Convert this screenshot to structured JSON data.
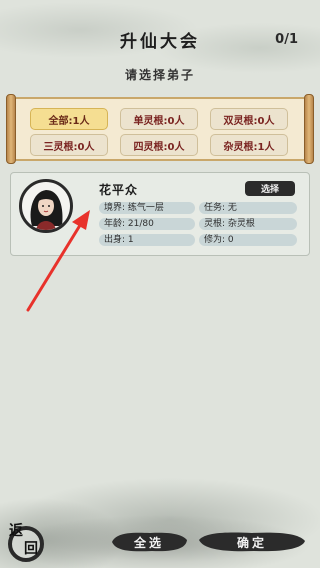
{
  "header": {
    "title": "升仙大会",
    "count": "0/1",
    "subtitle": "请选择弟子"
  },
  "filters": [
    {
      "label": "全部:1人",
      "active": true
    },
    {
      "label": "单灵根:0人",
      "active": false
    },
    {
      "label": "双灵根:0人",
      "active": false
    },
    {
      "label": "三灵根:0人",
      "active": false
    },
    {
      "label": "四灵根:0人",
      "active": false
    },
    {
      "label": "杂灵根:1人",
      "active": false
    }
  ],
  "disciple": {
    "name": "花平众",
    "select_label": "选择",
    "attributes": {
      "realm": "境界: 练气一层",
      "task": "任务: 无",
      "age": "年龄: 21/80",
      "root": "灵根: 杂灵根",
      "origin": "出身: 1",
      "cultivation": "修为: 0"
    }
  },
  "footer": {
    "back_char1": "返",
    "back_char2": "回",
    "select_all_label": "全选",
    "confirm_label": "确定"
  },
  "colors": {
    "background": "#dfe3dc",
    "scroll_paper": "#f4ead2",
    "filter_text": "#7a2320",
    "filter_active": "#f5de92",
    "attr_pill": "#c9d6d7",
    "ink": "#2b2b2b",
    "arrow": "#e8322b"
  },
  "icons": [
    "back-icon",
    "annotation-arrow-icon",
    "portrait-avatar-icon"
  ]
}
